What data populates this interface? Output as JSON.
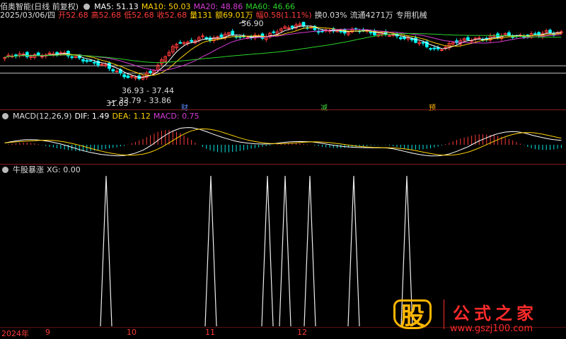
{
  "header": {
    "app_title": "佰奥智能(日线 前复权)",
    "ma5": "MA5: 51.13",
    "ma10": "MA10: 50.03",
    "ma20": "MA20: 48.86",
    "ma60": "MA60: 46.66",
    "date": "2025/03/06/四",
    "open": "开52.68",
    "high": "高52.68",
    "low": "低52.68",
    "close": "收52.68",
    "volume": "量131",
    "amount": "额69.01万",
    "change": "幅0.58(1.11%)",
    "turnover": "换0.03%",
    "float": "流通4271万",
    "industry": "专用机械"
  },
  "colors": {
    "ma5": "#ffffff",
    "ma10": "#ffd200",
    "ma20": "#d43cd4",
    "ma60": "#2bd12b",
    "up": "#ff3b3b",
    "down": "#00ffff",
    "dif": "#ffffff",
    "dea": "#ffd200",
    "macd": "#d43cd4"
  },
  "price_panel": {
    "high_label": "56.90",
    "low_label": "31.65",
    "range_label_1": "36.93 - 37.44",
    "range_label_2": "33.79 - 33.86",
    "markers": [
      "财",
      "减",
      "预"
    ]
  },
  "macd_panel": {
    "title": "MACD(12,26,9)",
    "dif": "DIF: 1.49",
    "dea": "DEA: 1.12",
    "macd": "MACD: 0.75"
  },
  "indicator_panel": {
    "title": "牛股暴涨",
    "xg": "XG: 0.00"
  },
  "xaxis": {
    "labels": [
      "2024年",
      "9",
      "10",
      "11",
      "12"
    ]
  },
  "watermark": {
    "mark": "股",
    "name": "公式之家",
    "url": "www.gszj100.com"
  },
  "chart_data": [
    {
      "type": "candlestick",
      "title": "佰奥智能(日线 前复权)",
      "series_names": [
        "MA5",
        "MA10",
        "MA20",
        "MA60"
      ],
      "annotations": {
        "high": 56.9,
        "low": 31.65,
        "band_1": [
          36.93,
          37.44
        ],
        "band_2": [
          33.79,
          33.86
        ]
      },
      "price_profile": [
        41,
        41.5,
        42,
        41.8,
        42.3,
        42.6,
        42.4,
        42.8,
        42.1,
        41.6,
        40.8,
        39.5,
        38.2,
        36.9,
        35.4,
        34.0,
        32.6,
        31.8,
        31.65,
        33.5,
        36.5,
        42.0,
        46.0,
        48.5,
        47.2,
        49.0,
        50.5,
        49.6,
        51.0,
        52.2,
        51.0,
        49.8,
        50.6,
        51.5,
        50.8,
        52.0,
        53.5,
        54.5,
        55.8,
        56.9,
        55.0,
        53.2,
        52.6,
        53.8,
        52.9,
        53.5,
        54.2,
        53.1,
        52.0,
        51.4,
        52.5,
        51.6,
        50.4,
        49.2,
        48.0,
        46.8,
        45.6,
        45.0,
        46.5,
        47.8,
        48.6,
        49.5,
        50.2,
        50.0,
        51.0,
        50.6,
        51.3,
        50.8,
        51.5,
        52.0,
        51.6,
        52.4,
        52.1,
        52.68
      ]
    },
    {
      "type": "bar",
      "title": "MACD(12,26,9)",
      "values_dif": 1.49,
      "values_dea": 1.12,
      "values_macd": 0.75,
      "macd_profile": [
        0.2,
        0.25,
        0.3,
        0.28,
        0.22,
        0.15,
        0.05,
        -0.1,
        -0.3,
        -0.5,
        -0.7,
        -0.9,
        -1.1,
        -1.2,
        -1.1,
        -0.8,
        -0.2,
        0.6,
        1.3,
        1.8,
        2.0,
        1.9,
        1.6,
        1.2,
        0.8,
        0.4,
        0.1,
        -0.1,
        -0.2,
        -0.15,
        0.05,
        0.25,
        0.4,
        0.5,
        0.45,
        0.3,
        0.1,
        -0.1,
        -0.3,
        -0.45,
        -0.55,
        -0.6,
        -0.7,
        -0.85,
        -0.95,
        -1.0,
        -1.0,
        -0.9,
        -0.7,
        -0.4,
        -0.1,
        0.3,
        0.6,
        0.9,
        1.1,
        1.2,
        1.15,
        1.0,
        0.9,
        0.8,
        0.75
      ]
    },
    {
      "type": "line",
      "title": "牛股暴涨",
      "signal_positions": [
        150,
        298,
        378,
        403,
        438,
        500,
        575
      ],
      "value": 0.0
    }
  ]
}
